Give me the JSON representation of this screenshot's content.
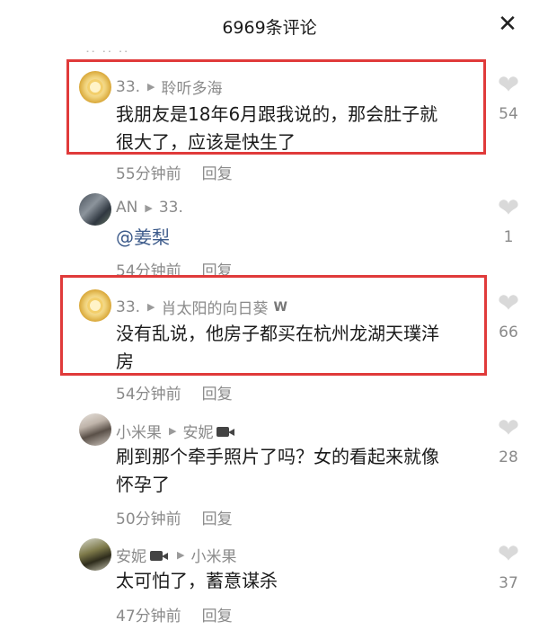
{
  "header": {
    "title": "6969条评论",
    "close_icon": "close-icon"
  },
  "partial_row": {
    "text": "·· ·· ··"
  },
  "comments": [
    {
      "user": "33.",
      "reply_to": "聆听多海",
      "text_lines": [
        "我朋友是18年6月跟我说的，那会肚子就",
        "很大了，应该是快生了"
      ],
      "time": "55分钟前",
      "reply": "回复",
      "likes": "54"
    },
    {
      "user": "AN",
      "reply_to": "33.",
      "text_lines": [
        "@姜梨"
      ],
      "time": "54分钟前",
      "reply": "回复",
      "likes": "1"
    },
    {
      "user": "33.",
      "reply_to": "肖太阳的向日葵",
      "badge": "W",
      "text_lines": [
        "没有乱说，他房子都买在杭州龙湖天璞洋",
        "房"
      ],
      "time": "54分钟前",
      "reply": "回复",
      "likes": "66"
    },
    {
      "user": "小米果",
      "reply_to": "安妮",
      "text_lines": [
        "刷到那个牵手照片了吗？女的看起来就像",
        "怀孕了"
      ],
      "time": "50分钟前",
      "reply": "回复",
      "likes": "28"
    },
    {
      "user": "安妮",
      "reply_to": "小米果",
      "text_lines": [
        "太可怕了，蓄意谋杀"
      ],
      "time": "47分钟前",
      "reply": "回复",
      "likes": "37"
    }
  ],
  "colors": {
    "highlight": "#e03a3a",
    "meta": "#8a8a8a",
    "mention": "#3c5a8a"
  }
}
